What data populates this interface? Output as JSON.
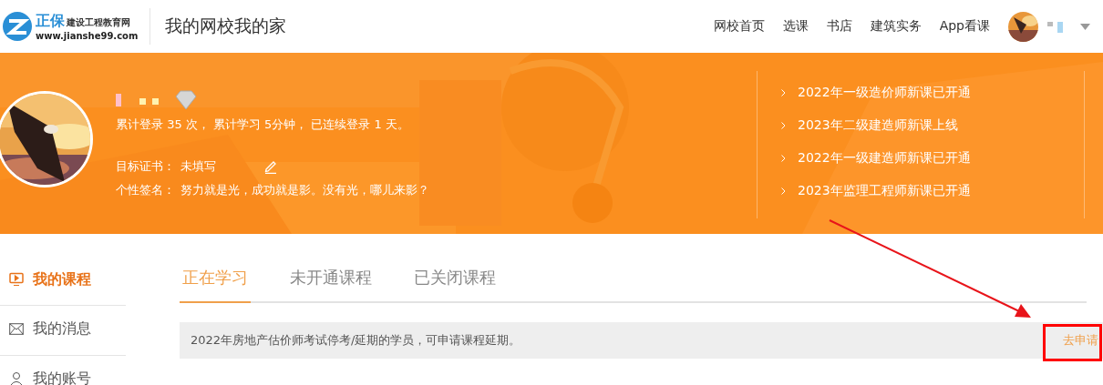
{
  "logo": {
    "brand": "正保",
    "tagline": "建设工程教育网",
    "url": "www.jianshe99.com"
  },
  "site_title": "我的网校我的家",
  "nav": [
    "网校首页",
    "选课",
    "书店",
    "建筑实务",
    "App看课"
  ],
  "profile": {
    "stats": "累计登录 35 次， 累计学习 5分钟， 已连续登录 1 天。",
    "target_label": "目标证书：",
    "target_value": "未填写",
    "signature_label": "个性签名：",
    "signature": "努力就是光，成功就是影。没有光，哪儿来影？"
  },
  "news": [
    "2022年一级造价师新课已开通",
    "2023年二级建造师新课上线",
    "2022年一级建造师新课已开通",
    "2023年监理工程师新课已开通"
  ],
  "sidebar": [
    {
      "label": "我的课程",
      "kind": "screen",
      "selected": true
    },
    {
      "label": "我的消息",
      "kind": "mail",
      "selected": false
    },
    {
      "label": "我的账号",
      "kind": "user",
      "selected": false
    }
  ],
  "tabs": [
    {
      "label": "正在学习",
      "selected": true
    },
    {
      "label": "未开通课程",
      "selected": false
    },
    {
      "label": "已关闭课程",
      "selected": false
    }
  ],
  "notice": {
    "text": "2022年房地产估价师考试停考/延期的学员，可申请课程延期。",
    "action": "去申请"
  }
}
